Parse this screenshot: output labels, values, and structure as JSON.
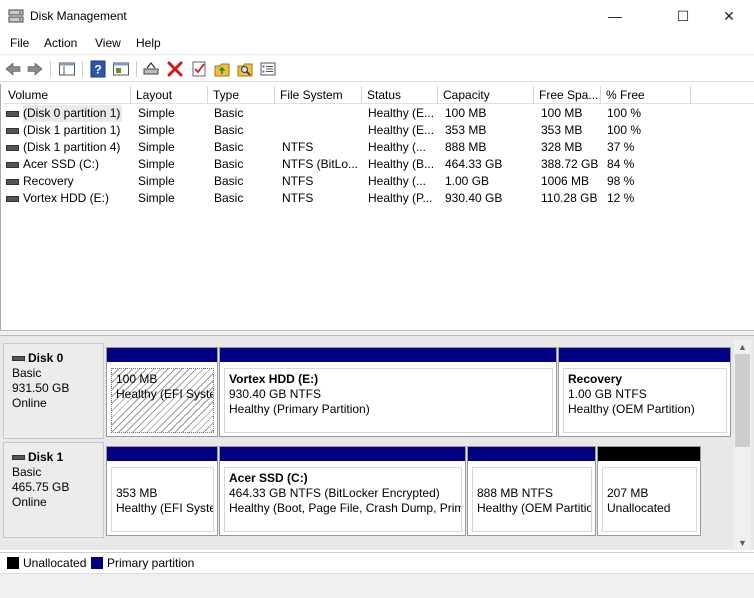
{
  "window": {
    "title": "Disk Management",
    "minimize_glyph": "—",
    "maximize_glyph": "☐",
    "close_glyph": "✕"
  },
  "menu": {
    "file": "File",
    "action": "Action",
    "view": "View",
    "help": "Help"
  },
  "toolbar": {
    "icons": [
      "back-arrow-icon",
      "forward-arrow-icon",
      "console-tree-icon",
      "help-icon",
      "properties-view-icon",
      "connect-disk-icon",
      "delete-icon",
      "checklist-icon",
      "up-folder-icon",
      "search-folder-icon",
      "settings-list-icon"
    ]
  },
  "table": {
    "headers": {
      "volume": "Volume",
      "layout": "Layout",
      "type": "Type",
      "filesystem": "File System",
      "status": "Status",
      "capacity": "Capacity",
      "freespace": "Free Spa...",
      "pctfree": "% Free"
    },
    "rows": [
      {
        "volume": "(Disk 0 partition 1)",
        "layout": "Simple",
        "type": "Basic",
        "filesystem": "",
        "status": "Healthy (E...",
        "capacity": "100 MB",
        "freespace": "100 MB",
        "pctfree": "100 %"
      },
      {
        "volume": "(Disk 1 partition 1)",
        "layout": "Simple",
        "type": "Basic",
        "filesystem": "",
        "status": "Healthy (E...",
        "capacity": "353 MB",
        "freespace": "353 MB",
        "pctfree": "100 %"
      },
      {
        "volume": "(Disk 1 partition 4)",
        "layout": "Simple",
        "type": "Basic",
        "filesystem": "NTFS",
        "status": "Healthy (...",
        "capacity": "888 MB",
        "freespace": "328 MB",
        "pctfree": "37 %"
      },
      {
        "volume": "Acer SSD (C:)",
        "layout": "Simple",
        "type": "Basic",
        "filesystem": "NTFS (BitLo...",
        "status": "Healthy (B...",
        "capacity": "464.33 GB",
        "freespace": "388.72 GB",
        "pctfree": "84 %"
      },
      {
        "volume": "Recovery",
        "layout": "Simple",
        "type": "Basic",
        "filesystem": "NTFS",
        "status": "Healthy (...",
        "capacity": "1.00 GB",
        "freespace": "1006 MB",
        "pctfree": "98 %"
      },
      {
        "volume": "Vortex HDD (E:)",
        "layout": "Simple",
        "type": "Basic",
        "filesystem": "NTFS",
        "status": "Healthy (P...",
        "capacity": "930.40 GB",
        "freespace": "110.28 GB",
        "pctfree": "12 %"
      }
    ]
  },
  "disks": [
    {
      "name": "Disk 0",
      "type": "Basic",
      "size": "931.50 GB",
      "state": "Online",
      "partitions": [
        {
          "name": "",
          "line1": "100 MB",
          "line2": "Healthy (EFI System Partition)"
        },
        {
          "name": "Vortex HDD  (E:)",
          "line1": "930.40 GB NTFS",
          "line2": "Healthy (Primary Partition)"
        },
        {
          "name": "Recovery",
          "line1": "1.00 GB NTFS",
          "line2": "Healthy (OEM Partition)"
        }
      ]
    },
    {
      "name": "Disk 1",
      "type": "Basic",
      "size": "465.75 GB",
      "state": "Online",
      "partitions": [
        {
          "name": "",
          "line1": "353 MB",
          "line2": "Healthy (EFI System Partition)"
        },
        {
          "name": "Acer SSD  (C:)",
          "line1": "464.33 GB NTFS (BitLocker Encrypted)",
          "line2": "Healthy (Boot, Page File, Crash Dump, Primary Partition)"
        },
        {
          "name": "",
          "line1": "888 MB NTFS",
          "line2": "Healthy (OEM Partition)"
        },
        {
          "name": "",
          "line1": "207 MB",
          "line2": "Unallocated"
        }
      ]
    }
  ],
  "scrollbar": {
    "up_glyph": "▲",
    "down_glyph": "▼"
  },
  "legend": {
    "unallocated": "Unallocated",
    "primary": "Primary partition",
    "colors": {
      "unallocated": "#000000",
      "primary": "#000080"
    }
  }
}
